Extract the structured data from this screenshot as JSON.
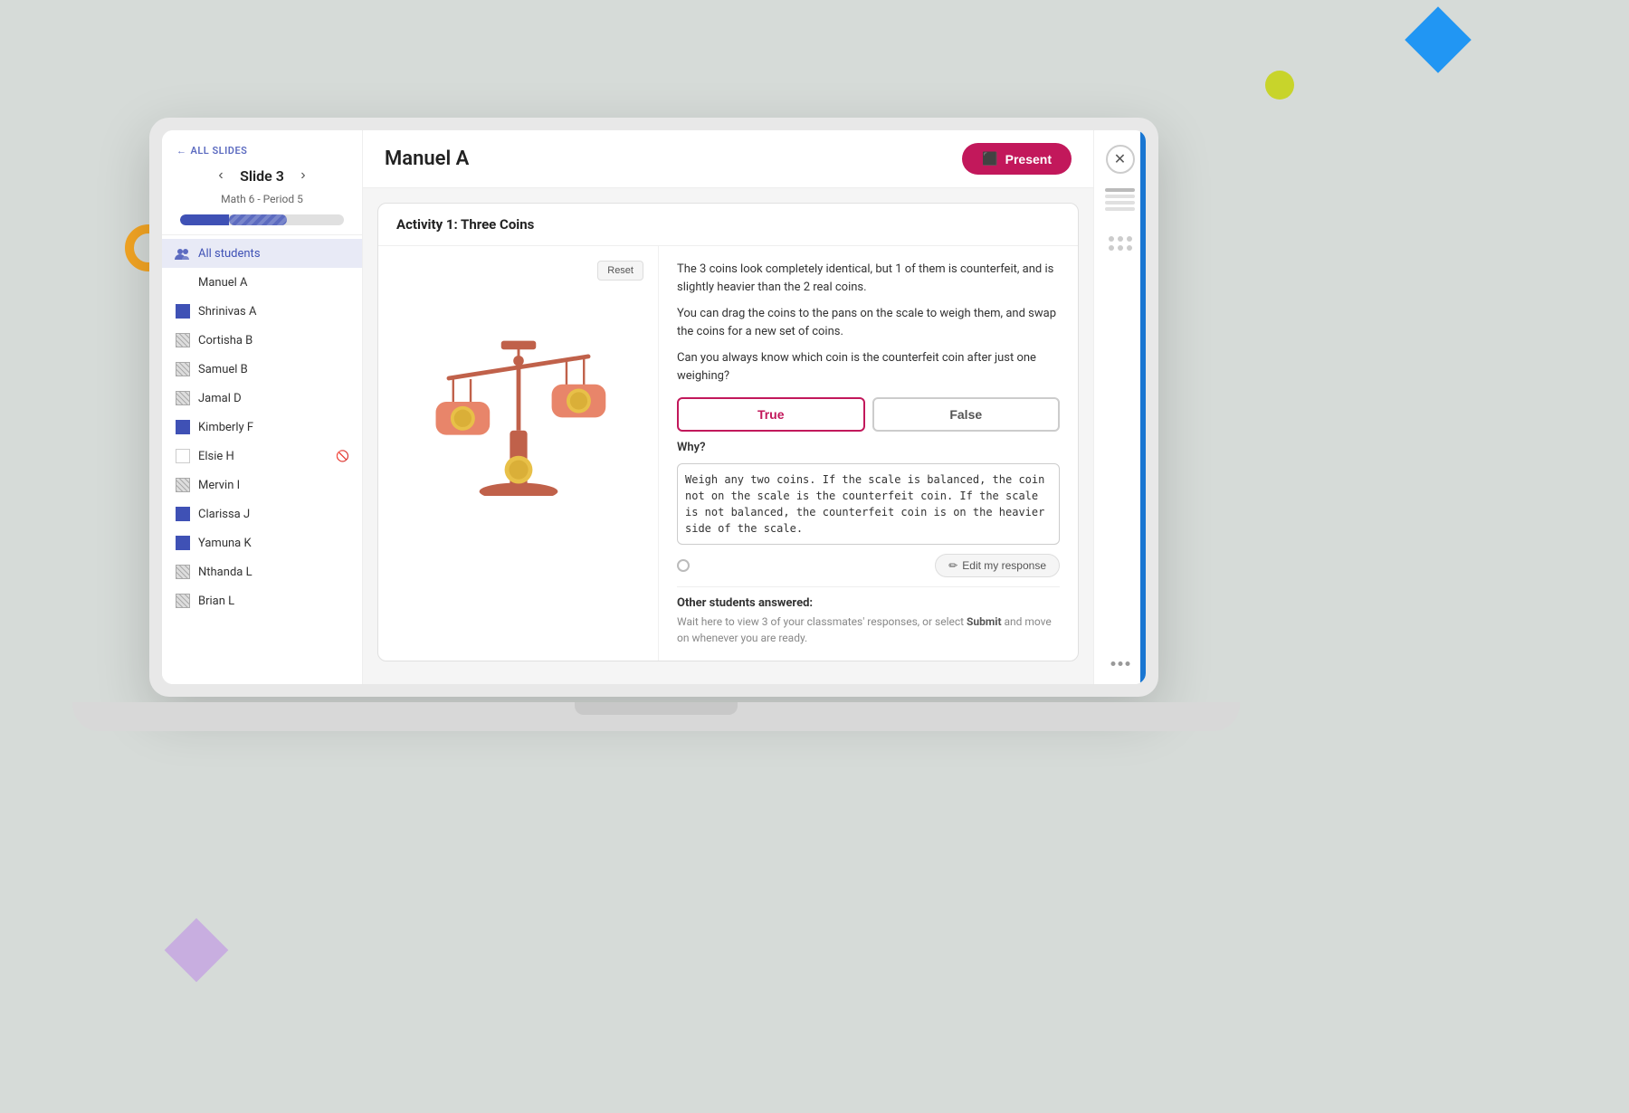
{
  "background_color": "#d6dbd8",
  "decorations": {
    "diamond_blue_color": "#2196F3",
    "circle_yellow_color": "#c8d42b",
    "circle_orange_color": "#f5a623",
    "diamond_purple_color": "#c8aee0"
  },
  "sidebar": {
    "all_slides_label": "ALL SLIDES",
    "slide_label": "Slide 3",
    "class_label": "Math 6 - Period 5",
    "all_students_label": "All students",
    "students": [
      {
        "name": "Manuel A",
        "icon": "none",
        "active": false
      },
      {
        "name": "Shrinivas A",
        "icon": "solid-blue",
        "active": false
      },
      {
        "name": "Cortisha B",
        "icon": "hatched",
        "active": false
      },
      {
        "name": "Samuel B",
        "icon": "hatched",
        "active": false
      },
      {
        "name": "Jamal D",
        "icon": "hatched",
        "active": false
      },
      {
        "name": "Kimberly F",
        "icon": "solid-blue",
        "active": false
      },
      {
        "name": "Elsie H",
        "icon": "white",
        "active": false,
        "muted": true
      },
      {
        "name": "Mervin I",
        "icon": "hatched",
        "active": false
      },
      {
        "name": "Clarissa J",
        "icon": "solid-blue",
        "active": false
      },
      {
        "name": "Yamuna K",
        "icon": "solid-blue",
        "active": false
      },
      {
        "name": "Nthanda L",
        "icon": "hatched",
        "active": false
      },
      {
        "name": "Brian L",
        "icon": "hatched",
        "active": false
      }
    ]
  },
  "top_bar": {
    "student_name": "Manuel A",
    "present_button_label": "Present"
  },
  "activity": {
    "title": "Activity 1: Three Coins",
    "reset_button": "Reset",
    "problem_text_1": "The 3 coins look completely identical, but 1 of them is counterfeit, and is slightly heavier than the 2 real coins.",
    "problem_text_2": "You can drag the coins to the pans on the scale to weigh them, and swap the coins for a new set of coins.",
    "problem_text_3": "Can you always know which coin is the counterfeit coin after just one weighing?",
    "true_button": "True",
    "false_button": "False",
    "why_label": "Why?",
    "why_answer": "Weigh any two coins. If the scale is balanced, the coin not on the scale is the counterfeit coin. If the scale is not balanced, the counterfeit coin is on the heavier side of the scale.",
    "edit_my_response_label": "Edit my response",
    "other_students_title": "Other students answered:",
    "other_students_text": "Wait here to view 3 of your classmates' responses, or select Submit and move on whenever you are ready."
  }
}
